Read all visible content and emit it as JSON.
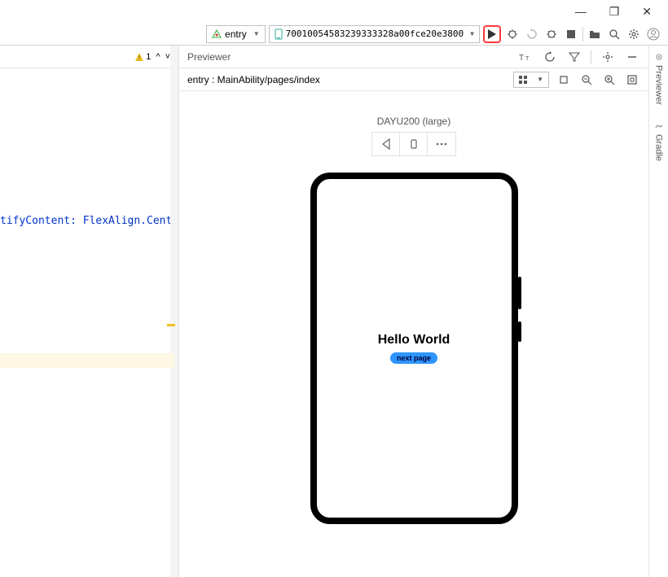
{
  "window_controls": {
    "min": "—",
    "max": "❐",
    "close": "✕"
  },
  "toolbar": {
    "module_label": "entry",
    "device_id": "70010054583239333328a00fce20e3800"
  },
  "left_pane": {
    "warning_count": "1",
    "nav_up": "^",
    "nav_down": "˅",
    "code_key": "tifyContent:",
    "code_val": " FlexAlign.Center"
  },
  "previewer": {
    "title": "Previewer",
    "breadcrumb": "entry : MainAbility/pages/index",
    "device_name": "DAYU200 (large)",
    "screen": {
      "hello": "Hello World",
      "next": "next page"
    }
  },
  "right_sidebar": {
    "tab1": "Previewer",
    "tab2": "Gradle"
  }
}
